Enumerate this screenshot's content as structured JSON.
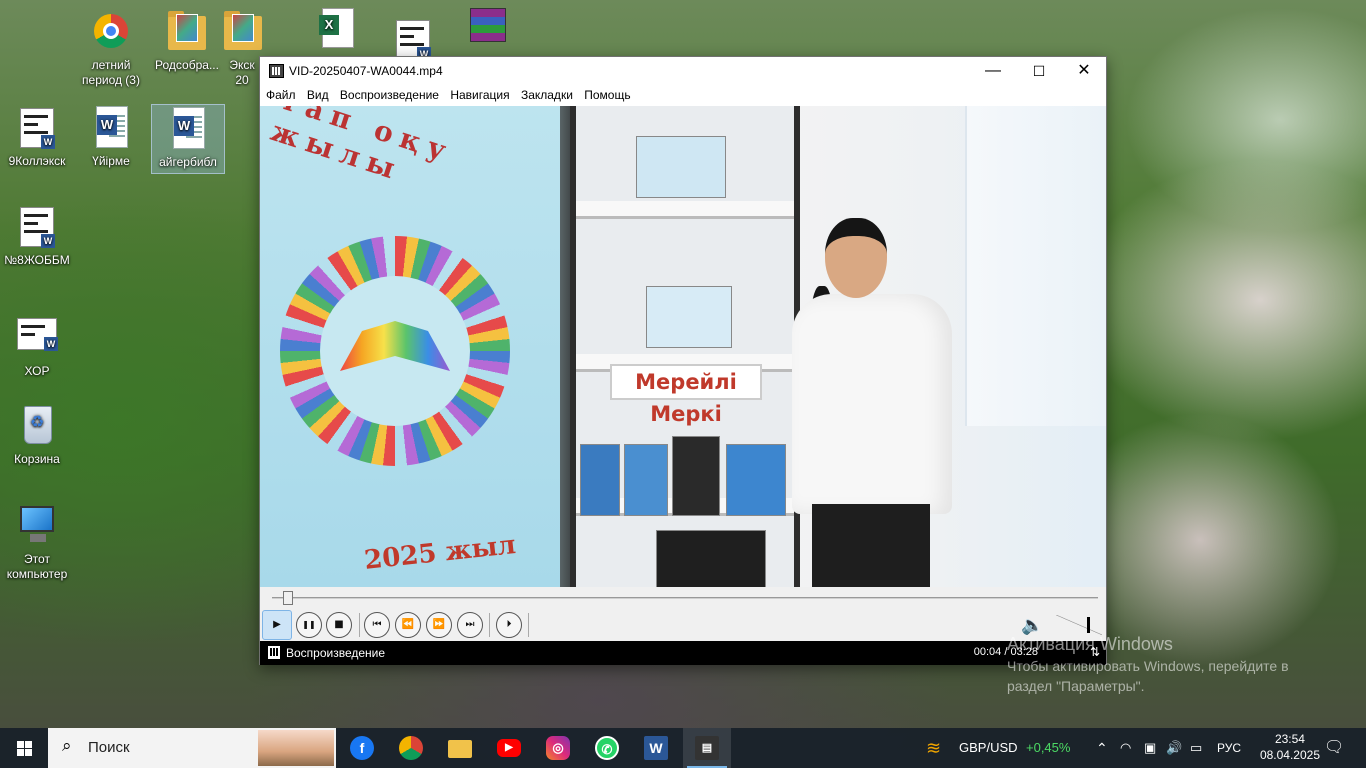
{
  "desktop": {
    "icons": [
      {
        "label": "летний период (3)",
        "icon": "chrome-shortcut-icon"
      },
      {
        "label": "Родсобра...",
        "icon": "folder-icon"
      },
      {
        "label": "Экск 20",
        "icon": "folder-icon"
      },
      {
        "label": "",
        "icon": "excel-document-icon"
      },
      {
        "label": "",
        "icon": "word-document-icon"
      },
      {
        "label": "",
        "icon": "winrar-archive-icon"
      },
      {
        "label": "9Коллэкск",
        "icon": "word-document-icon"
      },
      {
        "label": "Үйірме",
        "icon": "word-document-icon"
      },
      {
        "label": "айгербибл",
        "icon": "word-document-icon"
      },
      {
        "label": "№8ЖОББМ",
        "icon": "word-document-icon"
      },
      {
        "label": "ХОР",
        "icon": "word-document-icon"
      },
      {
        "label": "Корзина",
        "icon": "recycle-bin-icon"
      },
      {
        "label": "Этот компьютер",
        "icon": "this-pc-icon"
      }
    ]
  },
  "player": {
    "title": "VID-20250407-WA0044.mp4",
    "window_buttons": {
      "minimize": "—",
      "maximize": "☐",
      "close": "✕"
    },
    "menu": [
      "Файл",
      "Вид",
      "Воспроизведение",
      "Навигация",
      "Закладки",
      "Помощь"
    ],
    "video": {
      "banner_arc_text": "тап оқу жылы",
      "banner_year_text": "2025 жыл",
      "shelf_sign": "Мерейлі Меркі"
    },
    "seek_position": 0.019,
    "controls": {
      "play": "▶",
      "pause": "❚❚",
      "stop": "■",
      "prev": "⏮",
      "rewind": "⏪",
      "forward": "⏩",
      "next": "⏭",
      "frame_step": "⏵"
    },
    "volume_level": 0.7,
    "status": {
      "text": "Воспроизведение",
      "time": "00:04 / 03:28",
      "net_icon": "network-icon"
    }
  },
  "watermark": {
    "line1": "Активация Windows",
    "line2": "Чтобы активировать Windows, перейдите в",
    "line3": "раздел \"Параметры\"."
  },
  "taskbar": {
    "search_placeholder": "Поиск",
    "apps": [
      "facebook-icon",
      "chrome-icon",
      "file-explorer-icon",
      "youtube-icon",
      "instagram-icon",
      "whatsapp-icon",
      "word-icon",
      "media-player-classic-icon"
    ],
    "ticker_label": "GBP/USD",
    "ticker_change": "+0,45%",
    "language": "РУС",
    "time": "23:54",
    "date": "08.04.2025",
    "colors": {
      "ticker_positive": "#4cd964",
      "accent": "#7ab8ea"
    }
  }
}
